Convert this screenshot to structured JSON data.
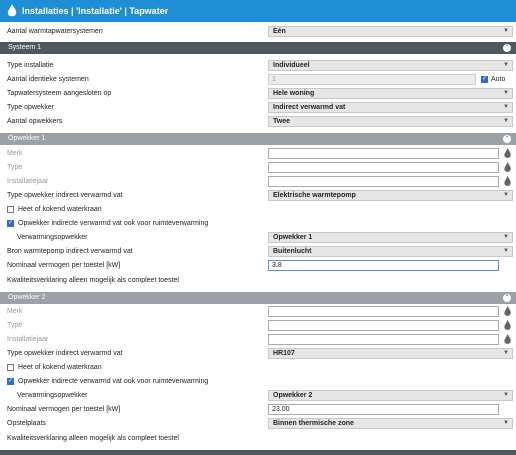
{
  "header": {
    "title": "Installaties | 'Installatie' | Tapwater"
  },
  "aantal_systemen": {
    "label": "Aantal warmtapwatersystemen",
    "value": "Eén"
  },
  "systeem1": {
    "title": "Systeem 1"
  },
  "type_installatie": {
    "label": "Type installatie",
    "value": "Individueel"
  },
  "aantal_identiek": {
    "label": "Aantal identieke systemen",
    "value": "1",
    "auto_label": "Auto"
  },
  "aangesloten": {
    "label": "Tapwatersysteem aangesloten op",
    "value": "Hele woning"
  },
  "type_opwekker": {
    "label": "Type opwekker",
    "value": "Indirect verwarmd vat"
  },
  "aantal_opwekkers": {
    "label": "Aantal opwekkers",
    "value": "Twee"
  },
  "opwekker1": {
    "title": "Opwekker 1",
    "merk": "Merk",
    "type": "Type",
    "jaar": "Installatiejaar",
    "type_indirect": {
      "label": "Type opwekker indirect verwarmd vat",
      "value": "Elektrische warmtepomp"
    },
    "heet": "Heet of kokend waterkraan",
    "ook_ruimte": "Opwekker indirecte verwarmd vat ook voor ruimteverwarming",
    "verwarmingsopwekker": {
      "label": "Verwarmingsopwekker",
      "value": "Opwekker 1"
    },
    "bron": {
      "label": "Bron warmtepomp indirect verwarmd vat",
      "value": "Buitenlucht"
    },
    "vermogen": {
      "label": "Nominaal vermogen per toestel [kW]",
      "value": "3.8"
    },
    "kwaliteit": "Kwaliteitsverklaring alleen mogelijk als compleet toestel"
  },
  "opwekker2": {
    "title": "Opwekker 2",
    "merk": "Merk",
    "type": "Type",
    "jaar": "Installatiejaar",
    "type_indirect": {
      "label": "Type opwekker indirect verwarmd vat",
      "value": "HR107"
    },
    "heet": "Heet of kokend waterkraan",
    "ook_ruimte": "Opwekker indirecte verwarmd vat ook voor ruimteverwarming",
    "verwarmingsopwekker": {
      "label": "Verwarmingsopwekker",
      "value": "Opwekker 2"
    },
    "vermogen": {
      "label": "Nominaal vermogen per toestel [kW]",
      "value": "23.00"
    },
    "opstelplaats": {
      "label": "Opstelplaats",
      "value": "Binnen thermische zone"
    },
    "kwaliteit": "Kwaliteitsverklaring alleen mogelijk als compleet toestel"
  },
  "colors": {
    "header": "#1e8fd6",
    "section_dark": "#4d5962",
    "section_grey": "#9ba1a6",
    "checkbox": "#2a6fd0"
  }
}
